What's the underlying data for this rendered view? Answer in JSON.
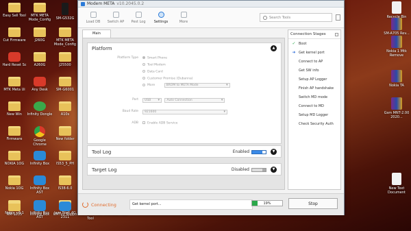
{
  "window": {
    "title": "Modem META",
    "title_suffix": "v10.2045.0.2"
  },
  "toolbar": {
    "items": [
      {
        "label": "Load DB",
        "icon": "database-icon"
      },
      {
        "label": "Switch AP",
        "icon": "switch-icon"
      },
      {
        "label": "Pest Log",
        "icon": "log-icon"
      },
      {
        "label": "Settings",
        "icon": "gear-icon"
      },
      {
        "label": "More",
        "icon": "more-icon"
      }
    ],
    "active_index": 3,
    "search_placeholder": "Search Tools"
  },
  "main_tab": "Main",
  "platform": {
    "title": "Platform",
    "platform_type_label": "Platform Type",
    "options": [
      "Smart Phone",
      "Tool Modem",
      "Data Card",
      "Customer Promise (Dubanna)",
      "More"
    ],
    "selected_option": "Smart Phone",
    "more_value": "BROM to META Mode",
    "port_label": "Port",
    "port_value": "USB",
    "port_mode_value": "Auto Connection",
    "baud_label": "Baud Rate",
    "baud_value": "921600",
    "adb_label": "ADB",
    "adb_checkbox": "Enable ADB Service"
  },
  "tool_log": {
    "title": "Tool Log",
    "status": "Enabled",
    "enabled": true
  },
  "target_log": {
    "title": "Target Log",
    "status": "Disabled",
    "enabled": false
  },
  "stages": {
    "title": "Connection Stages",
    "items": [
      {
        "label": "Boot",
        "state": "done"
      },
      {
        "label": "Get kernel port",
        "state": "current"
      },
      {
        "label": "Connect to AP",
        "state": "pending"
      },
      {
        "label": "Get SW info",
        "state": "pending"
      },
      {
        "label": "Setup AP Logger",
        "state": "pending"
      },
      {
        "label": "Finish AP handshake",
        "state": "pending"
      },
      {
        "label": "Switch MD mode",
        "state": "pending"
      },
      {
        "label": "Connect to MD",
        "state": "pending"
      },
      {
        "label": "Setup MD Logger",
        "state": "pending"
      },
      {
        "label": "Check Security Auth",
        "state": "pending"
      }
    ]
  },
  "bottom": {
    "connecting": "Connecting",
    "status_message": "Get kernel port...",
    "progress_percent": 19,
    "progress_text": "19%",
    "stop_label": "Stop"
  },
  "desktop_icons": [
    {
      "label": "Easy Sell Tool",
      "kind": "folder"
    },
    {
      "label": "MTK META Mode_Config",
      "kind": "folder"
    },
    {
      "label": "SM-G532G",
      "kind": "phone"
    },
    {
      "label": "Cut Firmware",
      "kind": "folder"
    },
    {
      "label": "J260G",
      "kind": "folder"
    },
    {
      "label": "MTK META Mode_Config",
      "kind": "folder"
    },
    {
      "label": "Hard Reset Sc",
      "kind": "red"
    },
    {
      "label": "A260G",
      "kind": "folder"
    },
    {
      "label": "J25500",
      "kind": "folder"
    },
    {
      "label": "MTK Meta Ui",
      "kind": "folder"
    },
    {
      "label": "Any Desk",
      "kind": "red"
    },
    {
      "label": "SM-G6001",
      "kind": "folder"
    },
    {
      "label": "New Win",
      "kind": "folder"
    },
    {
      "label": "Infinity Dongle",
      "kind": "green"
    },
    {
      "label": "A10s",
      "kind": "folder"
    },
    {
      "label": "Firmware",
      "kind": "folder"
    },
    {
      "label": "Google Chrome",
      "kind": "chrome"
    },
    {
      "label": "New folder",
      "kind": "folder"
    },
    {
      "label": "NOKIA 1OG",
      "kind": "folder"
    },
    {
      "label": "Infinity Box",
      "kind": "app"
    },
    {
      "label": "IS53_5_PH",
      "kind": "folder"
    },
    {
      "label": "Nokia 1OG",
      "kind": "folder"
    },
    {
      "label": "Infinity Box AST",
      "kind": "app"
    },
    {
      "label": "IS38-6.0",
      "kind": "folder"
    },
    {
      "label": "Nokia_v3.1",
      "kind": "folder"
    },
    {
      "label": "Infinity Box AST",
      "kind": "app"
    },
    {
      "label": "Jazz Digit 4G 2311",
      "kind": "folder"
    },
    {
      "label": "RM-1035",
      "kind": "folder"
    },
    {
      "label": "Infinity Box",
      "kind": "app"
    },
    {
      "label": "UMTv2 Suppo",
      "kind": "app"
    },
    {
      "label": "Ultimate Multi Tool",
      "kind": "app"
    },
    {
      "label": "Ultimate Multi",
      "kind": "app"
    }
  ],
  "desktop_right_icons": [
    {
      "label": "Recycle Bin",
      "kind": "file"
    },
    {
      "label": "SM-A705 Rev...",
      "kind": "rar"
    },
    {
      "label": "Nokia 1 Mtk Remove",
      "kind": "rar"
    },
    {
      "label": "Nokia TA",
      "kind": "rar"
    },
    {
      "label": "Gsm MNT-2.00 2020...",
      "kind": "rar"
    },
    {
      "label": "New Text Document",
      "kind": "file"
    }
  ]
}
